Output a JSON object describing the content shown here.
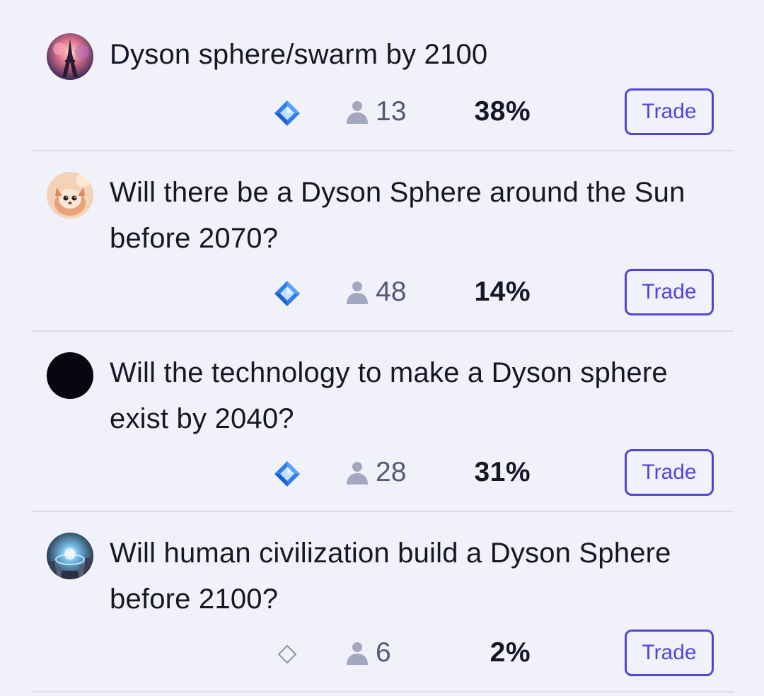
{
  "colors": {
    "background": "#f1f1fa",
    "accent": "#4f46d6",
    "text": "#161629",
    "muted": "#545a75",
    "diamond": "#3b82f6"
  },
  "markets": [
    {
      "title": "Dyson sphere/swarm by 2100",
      "avatar_icon": "eiffel-tower-avatar",
      "currency_icon": "mana-diamond-filled",
      "traders": "13",
      "probability": "38%",
      "trade_label": "Trade"
    },
    {
      "title": "Will there be a Dyson Sphere around the Sun before 2070?",
      "avatar_icon": "creature-avatar",
      "currency_icon": "mana-diamond-filled",
      "traders": "48",
      "probability": "14%",
      "trade_label": "Trade"
    },
    {
      "title": "Will the technology to make a Dyson sphere exist by 2040?",
      "avatar_icon": "black-circle-avatar",
      "currency_icon": "mana-diamond-filled",
      "traders": "28",
      "probability": "31%",
      "trade_label": "Trade"
    },
    {
      "title": "Will human civilization build a Dyson Sphere before 2100?",
      "avatar_icon": "scifi-city-avatar",
      "currency_icon": "mana-diamond-outline",
      "traders": "6",
      "probability": "2%",
      "trade_label": "Trade"
    }
  ]
}
